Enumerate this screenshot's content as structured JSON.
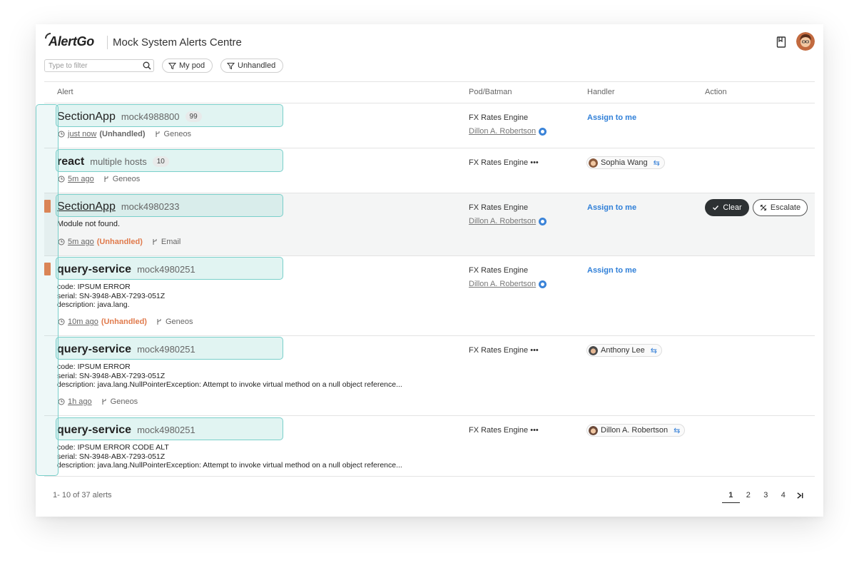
{
  "app": {
    "logo": "AlertGo",
    "title": "Mock System Alerts Centre"
  },
  "header": {
    "bookmark_icon": "bookmark-icon",
    "avatar_icon": "user-avatar"
  },
  "filters": {
    "search_placeholder": "Type to filter",
    "chips": [
      {
        "label": "My pod"
      },
      {
        "label": "Unhandled"
      }
    ]
  },
  "columns": {
    "alert": "Alert",
    "pod": "Pod/Batman",
    "handler": "Handler",
    "action": "Action"
  },
  "rows": [
    {
      "name": "SectionApp",
      "host": "mock4988800",
      "count": "99",
      "time": "just now",
      "unhandled": "(Unhandled)",
      "source": "Geneos",
      "pod": "FX Rates Engine",
      "batman": "Dillon A. Robertson",
      "assign": "Assign to me"
    },
    {
      "name": "react",
      "host": "multiple hosts",
      "count": "10",
      "time": "5m ago",
      "source": "Geneos",
      "pod": "FX Rates Engine •••",
      "handler": "Sophia Wang"
    },
    {
      "name": "SectionApp",
      "host": "mock4980233",
      "desc": "Module not found.",
      "time": "5m ago",
      "unhandled": "(Unhandled)",
      "source": "Email",
      "pod": "FX Rates Engine",
      "batman": "Dillon A. Robertson",
      "assign": "Assign to me",
      "clear": "Clear",
      "escalate": "Escalate"
    },
    {
      "name": "query-service",
      "host": "mock4980251",
      "desc": "code: IPSUM ERROR\nserial: SN-3948-ABX-7293-051Z\ndescription: java.lang.",
      "time": "10m ago",
      "unhandled": "(Unhandled)",
      "source": "Geneos",
      "pod": "FX Rates Engine",
      "batman": "Dillon A. Robertson",
      "assign": "Assign to me"
    },
    {
      "name": "query-service",
      "host": "mock4980251",
      "desc": "code: IPSUM ERROR\nserial: SN-3948-ABX-7293-051Z\ndescription: java.lang.NullPointerException: Attempt to invoke virtual method on a null object reference...",
      "time": "1h ago",
      "source": "Geneos",
      "pod": "FX Rates Engine •••",
      "handler": "Anthony Lee"
    },
    {
      "name": "query-service",
      "host": "mock4980251",
      "desc": "code: IPSUM ERROR CODE ALT\nserial: SN-3948-ABX-7293-051Z\ndescription: java.lang.NullPointerException: Attempt to invoke virtual method on a null object reference...",
      "pod": "FX Rates Engine •••",
      "handler": "Dillon A. Robertson"
    }
  ],
  "footer": {
    "count": "1- 10 of 37 alerts",
    "pages": [
      "1",
      "2",
      "3",
      "4"
    ],
    "current_page": "1",
    "last_icon": "last-page-icon"
  },
  "colors": {
    "accent": "#2f7fd8",
    "severity": "#e8773f",
    "highlight": "#79cfca",
    "dark_button": "#2d3133"
  }
}
